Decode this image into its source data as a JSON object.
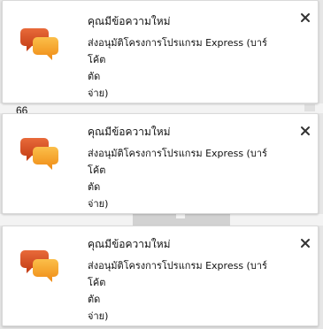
{
  "counter": "66",
  "notifications": [
    {
      "title": "คุณมีข้อความใหม่",
      "lines": [
        "ส่งอนุมัติโครงการโปรแกรม Express (บาร์",
        "โค้ต",
        "ตัด",
        "จ่าย)"
      ],
      "icon": "chat-bubbles-icon",
      "close_icon": "close-icon"
    },
    {
      "title": "คุณมีข้อความใหม่",
      "lines": [
        "ส่งอนุมัติโครงการโปรแกรม Express (บาร์",
        "โค้ต",
        "ตัด",
        "จ่าย)"
      ],
      "icon": "chat-bubbles-icon",
      "close_icon": "close-icon"
    },
    {
      "title": "คุณมีข้อความใหม่",
      "lines": [
        "ส่งอนุมัติโครงการโปรแกรม Express (บาร์",
        "โค้ต",
        "ตัด",
        "จ่าย)"
      ],
      "icon": "chat-bubbles-icon",
      "close_icon": "close-icon"
    }
  ],
  "colors": {
    "bubble_back": "#d9481d",
    "bubble_front": "#f59a1f",
    "close": "#333333"
  }
}
